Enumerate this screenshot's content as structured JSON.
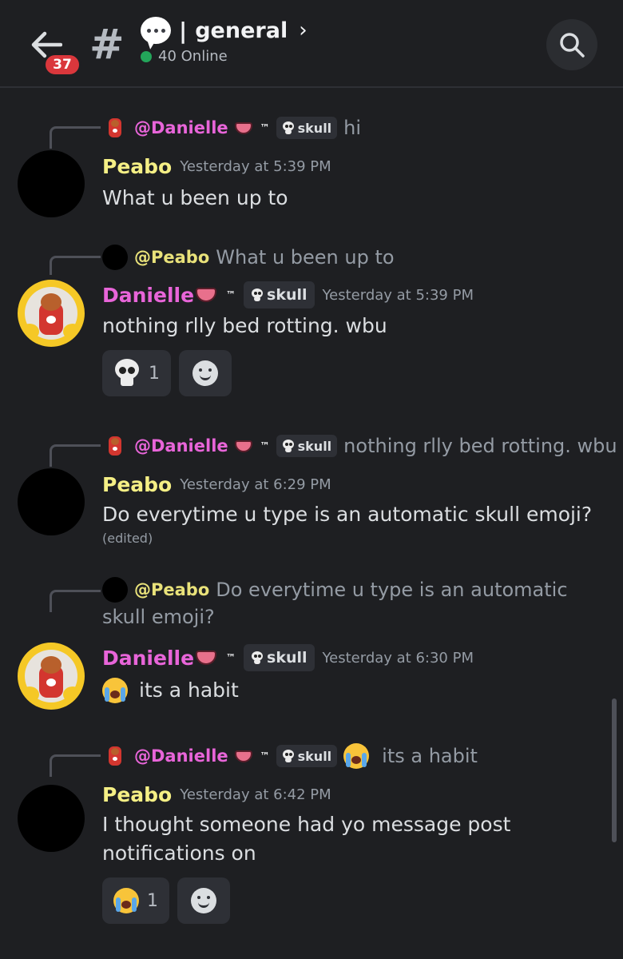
{
  "header": {
    "unread_count": "37",
    "channel_name": "general",
    "separator": "|",
    "online_text": "40 Online"
  },
  "messages": [
    {
      "reply": {
        "name": "@Danielle",
        "tag": "skull",
        "text": "hi"
      },
      "author": "Peabo",
      "timestamp": "Yesterday at 5:39 PM",
      "content": "What u been up to"
    },
    {
      "reply": {
        "name": "@Peabo",
        "text": "What u been up to"
      },
      "author": "Danielle",
      "tag": "skull",
      "timestamp": "Yesterday at 5:39 PM",
      "content": "nothing rlly bed rotting. wbu",
      "reactions": [
        {
          "emoji": "skull",
          "count": "1"
        }
      ]
    },
    {
      "reply": {
        "name": "@Danielle",
        "tag": "skull",
        "text": "nothing rlly bed rotting. wbu"
      },
      "author": "Peabo",
      "timestamp": "Yesterday at 6:29 PM",
      "content": "Do everytime u type is an automatic skull emoji?",
      "edited": "(edited)"
    },
    {
      "reply": {
        "name": "@Peabo",
        "text_line1": "Do everytime u type is an automatic",
        "text_line2": "skull emoji?"
      },
      "author": "Danielle",
      "tag": "skull",
      "timestamp": "Yesterday at 6:30 PM",
      "content": "its a habit"
    },
    {
      "reply": {
        "name": "@Danielle",
        "tag": "skull",
        "text": "its a habit"
      },
      "author": "Peabo",
      "timestamp": "Yesterday at 6:42 PM",
      "content_line1": "I thought someone had yo message post",
      "content_line2": "notifications on",
      "reactions": [
        {
          "emoji": "loudly-crying-face",
          "count": "1"
        }
      ]
    }
  ],
  "tm_mark": "™",
  "colors": {
    "background": "#1e1f22",
    "peabo_name": "#f5ef85",
    "danielle_name": "#e865d9",
    "badge": "#da373c",
    "online_dot": "#23a55a"
  }
}
